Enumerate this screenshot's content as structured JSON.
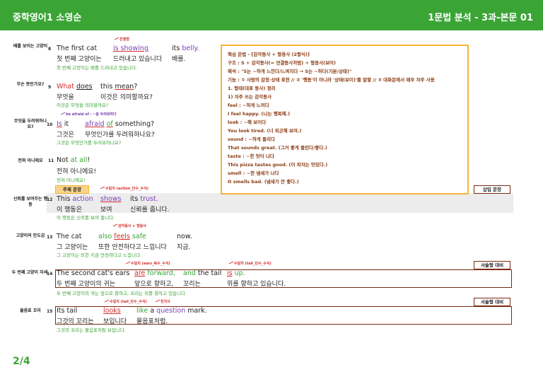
{
  "header": {
    "left_title": "중학영어1 소영순",
    "right_title": "1문법 분석 - 3과-본문 01"
  },
  "rows": [
    {
      "num": "8",
      "side": "배를 보이는 고양이",
      "ann": "진행형",
      "en": [
        "The first cat",
        "is showing",
        "its belly."
      ],
      "ko": [
        "첫 번째 고양이는",
        "드러내고 있습니다",
        "배를."
      ],
      "tr": "첫 번째 고양이는 배를 드러내고 있습니다."
    },
    {
      "num": "9",
      "side": "무슨 뜻인가요?",
      "en": [
        "What does",
        "this mean?"
      ],
      "ko": [
        "무엇을",
        "이것은 의미할까요?"
      ],
      "tr": "이것은 무엇을 의미할까요?"
    },
    {
      "num": "10",
      "side": "무엇을 두려워하나요?",
      "ann": "be afraid of : ~을 두려워하다",
      "en": [
        "Is it",
        "afraid of something?"
      ],
      "ko": [
        "그것은",
        "무엇인가를 두려워하나요?"
      ],
      "tr": "그것은 무엇인가를 두려워하나요?"
    },
    {
      "num": "11",
      "side": "전혀 아니에요",
      "en": [
        "Not at all!"
      ],
      "ko": [
        "전혀 아니에요!"
      ],
      "tr": "전혀 아니에요!"
    },
    {
      "num": "12",
      "side": "신뢰를 보여주는 행동",
      "ann": "수일치 (action_단수_수식)",
      "tag": "주제 문장",
      "en": [
        "This action",
        "shows",
        "its trust."
      ],
      "ko": [
        "이 행동은",
        "보여",
        "신뢰를 줍니다."
      ],
      "tr": "이 행동은 신뢰를 보여 줍니다."
    },
    {
      "num": "13",
      "side": "고양이의 안도감",
      "ann": "감각동사 + 형용사",
      "en": [
        "The cat",
        "also feels safe",
        "now."
      ],
      "ko": [
        "그 고양이는",
        "또한 안전하다고 느낍니다",
        "지금."
      ],
      "tr": "그 고양이는 또한 지금 안전하다고 느낍니다."
    },
    {
      "num": "14",
      "side": "두 번째 고양이 자세",
      "ann1": "수일치 (ears_복수_수식)",
      "ann2": "수일치 (tail_단수_수식)",
      "en": [
        "The second cat's ears",
        "are forward,",
        "and the tail",
        "is up."
      ],
      "ko": [
        "두 번째 고양이의 귀는",
        "앞으로 향하고,",
        "꼬리는",
        "위를 향하고 있습니다."
      ],
      "tr": "두 번째 고양이의 귀는 앞으로 향하고, 꼬리는 위를 향하고 있습니다."
    },
    {
      "num": "15",
      "side": "물음표 꼬리",
      "ann1": "수일치 (tail_단수_수식)",
      "ann2": "전치사",
      "en": [
        "Its tail",
        "looks",
        "like a question mark."
      ],
      "ko": [
        "그것의 꼬리는",
        "보입니다",
        "물음표처럼."
      ],
      "tr": "그것의 꼬리는 물음표처럼 보입니다."
    }
  ],
  "right_tags": {
    "insert": "삽입 문장",
    "essay1": "서술형 대비",
    "essay2": "서술형 대비"
  },
  "grammar_box": {
    "lines": [
      "핵심 문법 - [감각동사 + 형용사 (2형식)]",
      "구조 : S + 감각동사(= 연결동사처럼) + 형용사(보어)",
      "해석 : \"S는 ~하게 느낀다/느껴지다 → S는 ~하다(기분/상태)\"",
      "기능 : ① 사람의 감정·상태 표현 // ② '행동'이 아니라 '상태(보이)'를 말할 // ③ 대화문에서 매우 자주 사용",
      "1. 형태(대표 동사) 정리",
      "1) 자주 쓰는 감각동사",
      "feel : ~하게 느끼다",
      "I feel happy. (나는 행복해.)",
      "look : ~해 보이다",
      "You look tired. (너 피곤해 보여.)",
      "sound : ~하게 들리다",
      "That sounds great. (그거 좋게 들린다/좋다.)",
      "taste : ~한 맛이 나다",
      "This pizza tastes good. (이 피자는 맛있다.)",
      "smell : ~한 냄새가 나다",
      "It smells bad. (냄새가 안 좋다.)"
    ]
  },
  "footer": {
    "page": "2/4"
  }
}
